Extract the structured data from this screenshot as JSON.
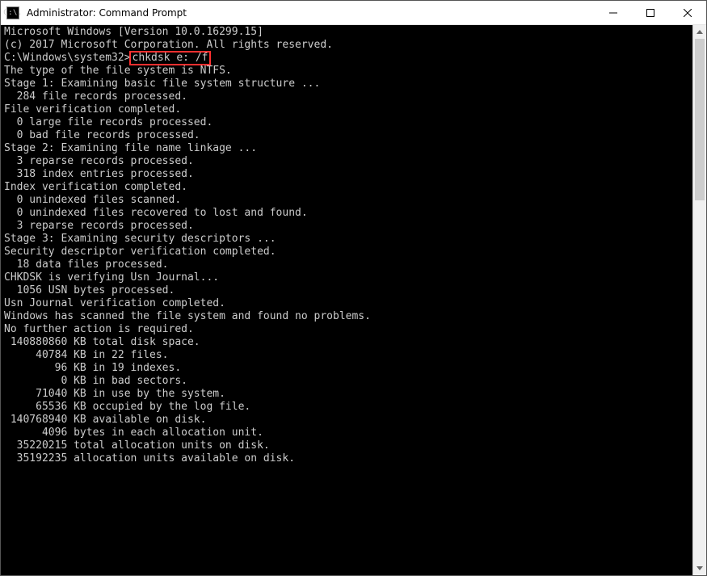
{
  "window": {
    "title": "Administrator: Command Prompt",
    "cmd_icon_text": "C:\\."
  },
  "prompt": {
    "path": "C:\\Windows\\system32>",
    "command": "chkdsk e: /f"
  },
  "lines": {
    "l00": "Microsoft Windows [Version 10.0.16299.15]",
    "l01": "(c) 2017 Microsoft Corporation. All rights reserved.",
    "l02": "",
    "l04": "The type of the file system is NTFS.",
    "l05": "",
    "l06": "Stage 1: Examining basic file system structure ...",
    "l07": "  284 file records processed.",
    "l08": "File verification completed.",
    "l09": "  0 large file records processed.",
    "l10": "  0 bad file records processed.",
    "l11": "",
    "l12": "Stage 2: Examining file name linkage ...",
    "l13": "  3 reparse records processed.",
    "l14": "  318 index entries processed.",
    "l15": "Index verification completed.",
    "l16": "  0 unindexed files scanned.",
    "l17": "  0 unindexed files recovered to lost and found.",
    "l18": "  3 reparse records processed.",
    "l19": "",
    "l20": "Stage 3: Examining security descriptors ...",
    "l21": "Security descriptor verification completed.",
    "l22": "  18 data files processed.",
    "l23": "CHKDSK is verifying Usn Journal...",
    "l24": "  1056 USN bytes processed.",
    "l25": "Usn Journal verification completed.",
    "l26": "",
    "l27": "Windows has scanned the file system and found no problems.",
    "l28": "No further action is required.",
    "l29": "",
    "l30": " 140880860 KB total disk space.",
    "l31": "     40784 KB in 22 files.",
    "l32": "        96 KB in 19 indexes.",
    "l33": "         0 KB in bad sectors.",
    "l34": "     71040 KB in use by the system.",
    "l35": "     65536 KB occupied by the log file.",
    "l36": " 140768940 KB available on disk.",
    "l37": "",
    "l38": "      4096 bytes in each allocation unit.",
    "l39": "  35220215 total allocation units on disk.",
    "l40": "  35192235 allocation units available on disk."
  }
}
